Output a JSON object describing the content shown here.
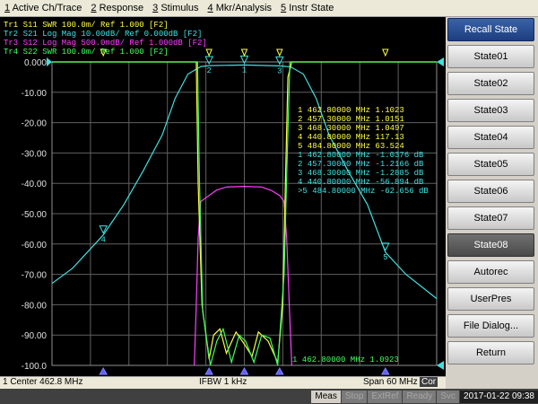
{
  "menu": [
    {
      "acc": "1",
      "label": " Active Ch/Trace"
    },
    {
      "acc": "2",
      "label": " Response"
    },
    {
      "acc": "3",
      "label": " Stimulus"
    },
    {
      "acc": "4",
      "label": " Mkr/Analysis"
    },
    {
      "acc": "5",
      "label": " Instr State"
    }
  ],
  "traces": [
    {
      "label": "Tr1  S11  SWR 100.0m/ Ref 1.000  [F2]",
      "color": "#ffff40"
    },
    {
      "label": "Tr2  S21  Log Mag 10.00dB/ Ref 0.000dB  [F2]",
      "color": "#40e0e0"
    },
    {
      "label": "Tr3  S12  Log Mag 500.0mdB/ Ref 1.000dB  [F2]",
      "color": "#ff40ff"
    },
    {
      "label": "Tr4  S22  SWR 100.0m/ Ref 1.000  [F2]",
      "color": "#40ff60"
    }
  ],
  "marker_table": [
    {
      "label": "1   462.80000 MHz  1.1023",
      "color": "#ffff40"
    },
    {
      "label": "2   457.30000 MHz  1.0151",
      "color": "#ffff40"
    },
    {
      "label": "3   468.30000 MHz  1.0497",
      "color": "#ffff40"
    },
    {
      "label": "4   440.80000 MHz  117.13",
      "color": "#ffff40"
    },
    {
      "label": "5   484.80000 MHz  63.524",
      "color": "#ffff40"
    },
    {
      "label": "1   462.80000 MHz  -1.0376 dB",
      "color": "#40e0e0"
    },
    {
      "label": "2   457.30000 MHz  -1.2166 dB",
      "color": "#40e0e0"
    },
    {
      "label": "3   468.30000 MHz  -1.2885 dB",
      "color": "#40e0e0"
    },
    {
      "label": "4   440.80000 MHz  -56.894 dB",
      "color": "#40e0e0"
    },
    {
      ">5": "",
      "label": ">5  484.80000 MHz  -62.656 dB",
      "color": "#40e0e0"
    }
  ],
  "bottom_marker": {
    "label": "1   462.80000 MHz  1.0923",
    "color": "#40ff60"
  },
  "chart_data": {
    "type": "line",
    "ylabel_ticks": [
      "0.000",
      "-10.00",
      "-20.00",
      "-30.00",
      "-40.00",
      "-50.00",
      "-60.00",
      "-70.00",
      "-80.00",
      "-90.00",
      "-100.0"
    ],
    "ylim": [
      -100,
      0
    ],
    "xlim_mhz": [
      432.8,
      492.8
    ],
    "grid": true,
    "series": [
      {
        "name": "S21",
        "color": "#40e0e0",
        "x": [
          432.8,
          436,
          440.8,
          444,
          447,
          450,
          452,
          454,
          456,
          457.3,
          462.8,
          468.3,
          470,
          472,
          474,
          476,
          479,
          482,
          484.8,
          488,
          492.8
        ],
        "y": [
          -73,
          -68,
          -57,
          -47,
          -36,
          -24,
          -12,
          -4,
          -1.5,
          -1.2,
          -1.0,
          -1.3,
          -1.6,
          -4,
          -12,
          -24,
          -36,
          -47,
          -62.7,
          -70,
          -78
        ]
      },
      {
        "name": "S12",
        "color": "#ff40ff",
        "x": [
          455,
          455.3,
          455.6,
          456,
          457.3,
          458.5,
          460,
          462.8,
          465.5,
          467,
          468.3,
          469,
          469.4,
          469.8,
          470.2
        ],
        "y": [
          -100,
          -80,
          -58,
          -46,
          -44,
          -42.2,
          -41.2,
          -41,
          -41.2,
          -42.3,
          -44,
          -46,
          -58,
          -80,
          -100
        ]
      },
      {
        "name": "S11",
        "color": "#ffff40",
        "x": [
          432.8,
          455.3,
          455.6,
          456.2,
          457.3,
          458,
          459,
          460,
          461.5,
          462.8,
          464,
          465,
          466.5,
          468,
          468.8,
          469.2,
          469.6,
          470.2,
          492.8
        ],
        "y": [
          0,
          0,
          -40,
          -80,
          -98,
          -90,
          -88,
          -96,
          -89,
          -93,
          -97,
          -89,
          -92,
          -99,
          -80,
          -40,
          -5,
          0,
          0
        ]
      },
      {
        "name": "S22",
        "color": "#40ff60",
        "x": [
          432.8,
          455.5,
          455.8,
          456.3,
          457.5,
          458.5,
          459.5,
          460.8,
          462,
          463,
          464.3,
          465.5,
          466.8,
          468,
          469,
          469.5,
          469.9,
          492.8
        ],
        "y": [
          0,
          0,
          -40,
          -82,
          -100,
          -92,
          -88,
          -99,
          -90,
          -92,
          -99,
          -90,
          -91,
          -100,
          -70,
          -30,
          0,
          0
        ]
      }
    ],
    "markers": [
      {
        "id": "1",
        "x": 462.8,
        "trace": "S21"
      },
      {
        "id": "2",
        "x": 457.3,
        "trace": "S21"
      },
      {
        "id": "3",
        "x": 468.3,
        "trace": "S21"
      },
      {
        "id": "4",
        "x": 440.8,
        "trace": "S21"
      },
      {
        "id": "5",
        "x": 484.8,
        "trace": "S21"
      }
    ]
  },
  "softkeys": [
    {
      "label": "Recall State",
      "kind": "title"
    },
    {
      "label": "State01",
      "kind": "normal"
    },
    {
      "label": "State02",
      "kind": "normal"
    },
    {
      "label": "State03",
      "kind": "normal"
    },
    {
      "label": "State04",
      "kind": "normal"
    },
    {
      "label": "State05",
      "kind": "normal"
    },
    {
      "label": "State06",
      "kind": "normal"
    },
    {
      "label": "State07",
      "kind": "normal"
    },
    {
      "label": "State08",
      "kind": "active"
    },
    {
      "label": "Autorec",
      "kind": "normal"
    },
    {
      "label": "UserPres",
      "kind": "normal"
    },
    {
      "label": "File Dialog...",
      "kind": "normal"
    },
    {
      "label": "Return",
      "kind": "normal"
    }
  ],
  "status": {
    "center": "1  Center 462.8 MHz",
    "ifbw": "IFBW 1 kHz",
    "span": "Span 60 MHz",
    "cor": "Cor",
    "meas": "Meas",
    "stop": "Stop",
    "extref": "ExtRef",
    "ready": "Ready",
    "svc": "Svc",
    "datetime": "2017-01-22 09:38"
  }
}
